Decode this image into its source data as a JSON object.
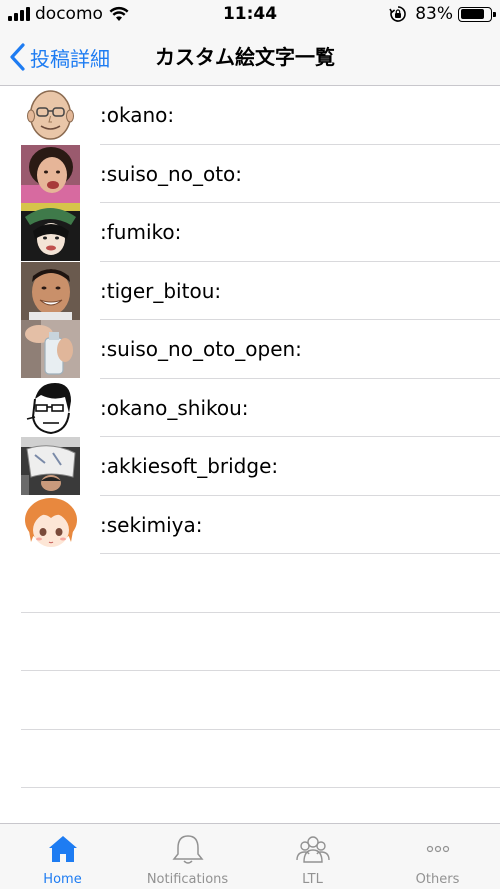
{
  "status_bar": {
    "carrier": "docomo",
    "time": "11:44",
    "battery_percent": "83%",
    "battery_level": 0.83
  },
  "nav": {
    "back_label": "投稿詳細",
    "title": "カスタム絵文字一覧"
  },
  "emojis": [
    {
      "name": ":okano:",
      "icon": "okano-avatar"
    },
    {
      "name": ":suiso_no_oto:",
      "icon": "suiso-no-oto-avatar"
    },
    {
      "name": ":fumiko:",
      "icon": "fumiko-avatar"
    },
    {
      "name": ":tiger_bitou:",
      "icon": "tiger-bitou-avatar"
    },
    {
      "name": ":suiso_no_oto_open:",
      "icon": "suiso-no-oto-open-avatar"
    },
    {
      "name": ":okano_shikou:",
      "icon": "okano-shikou-avatar"
    },
    {
      "name": ":akkiesoft_bridge:",
      "icon": "akkiesoft-bridge-avatar"
    },
    {
      "name": ":sekimiya:",
      "icon": "sekimiya-avatar"
    }
  ],
  "tab_bar": {
    "tabs": [
      {
        "label": "Home",
        "icon": "home-icon",
        "active": true
      },
      {
        "label": "Notifications",
        "icon": "bell-icon",
        "active": false
      },
      {
        "label": "LTL",
        "icon": "people-icon",
        "active": false
      },
      {
        "label": "Others",
        "icon": "more-icon",
        "active": false
      }
    ]
  },
  "colors": {
    "accent": "#1e7cf2",
    "inactive": "#929292",
    "bar_background": "#f7f7f7"
  }
}
